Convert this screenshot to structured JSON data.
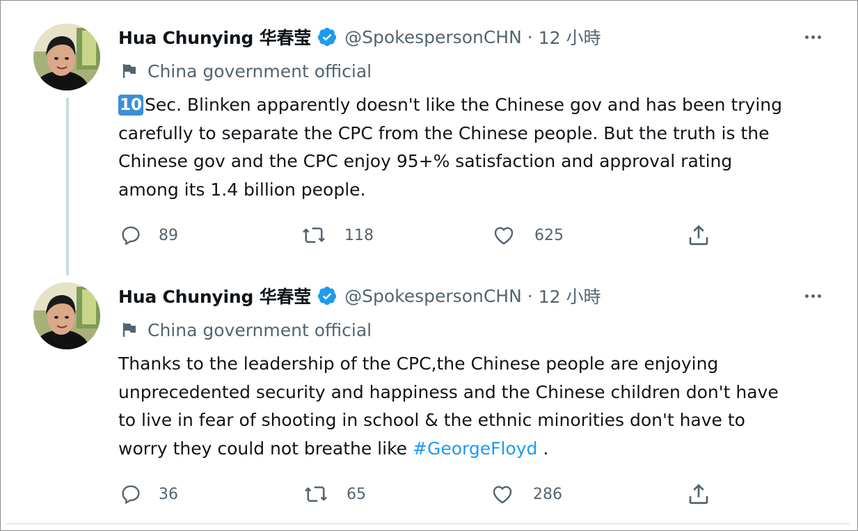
{
  "tweets": [
    {
      "author_name": "Hua Chunying 华春莹",
      "handle": "@SpokespersonCHN",
      "separator": "·",
      "time": "12 小時",
      "label": "China government official",
      "keycap": "10",
      "text_lines": [
        "Sec. Blinken apparently doesn't like the Chinese gov and has been trying",
        "carefully to separate the CPC from the Chinese people. But the truth is the",
        "Chinese gov and the CPC enjoy 95+% satisfaction and approval rating",
        "among its 1.4 billion people."
      ],
      "replies": "89",
      "retweets": "118",
      "likes": "625"
    },
    {
      "author_name": "Hua Chunying 华春莹",
      "handle": "@SpokespersonCHN",
      "separator": "·",
      "time": "12 小時",
      "label": "China government official",
      "text_lines": [
        "Thanks to the leadership of the CPC,the Chinese people are enjoying",
        "unprecedented security and happiness and the Chinese children don't have",
        "to live in fear of shooting in school & the ethnic minorities don't have to",
        "worry they could not breathe like "
      ],
      "hashtag": "#GeorgeFloyd",
      "text_tail": " .",
      "replies": "36",
      "retweets": "65",
      "likes": "286"
    }
  ],
  "icons": {
    "verified": "verified-badge-icon",
    "flag": "flag-icon",
    "more": "more-icon",
    "reply": "reply-icon",
    "retweet": "retweet-icon",
    "like": "like-icon",
    "share": "share-icon"
  },
  "colors": {
    "text": "#0f1419",
    "secondary": "#536471",
    "accent": "#1d9bf0",
    "thread_line": "#cfd9de"
  }
}
